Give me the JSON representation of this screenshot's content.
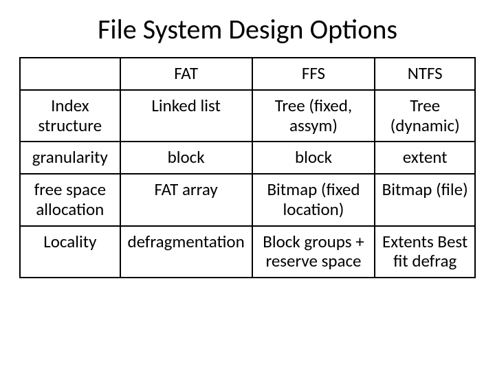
{
  "title": "File System Design Options",
  "table": {
    "headers": [
      "",
      "FAT",
      "FFS",
      "NTFS"
    ],
    "rows": [
      {
        "label": "Index structure",
        "fat": "Linked list",
        "ffs": "Tree (fixed, assym)",
        "ntfs": "Tree (dynamic)"
      },
      {
        "label": "granularity",
        "fat": "block",
        "ffs": "block",
        "ntfs": "extent"
      },
      {
        "label": "free space allocation",
        "fat": "FAT array",
        "ffs": "Bitmap (fixed location)",
        "ntfs": "Bitmap (file)"
      },
      {
        "label": "Locality",
        "fat": "defragmentation",
        "ffs": "Block groups + reserve space",
        "ntfs": "Extents Best fit defrag"
      }
    ]
  }
}
